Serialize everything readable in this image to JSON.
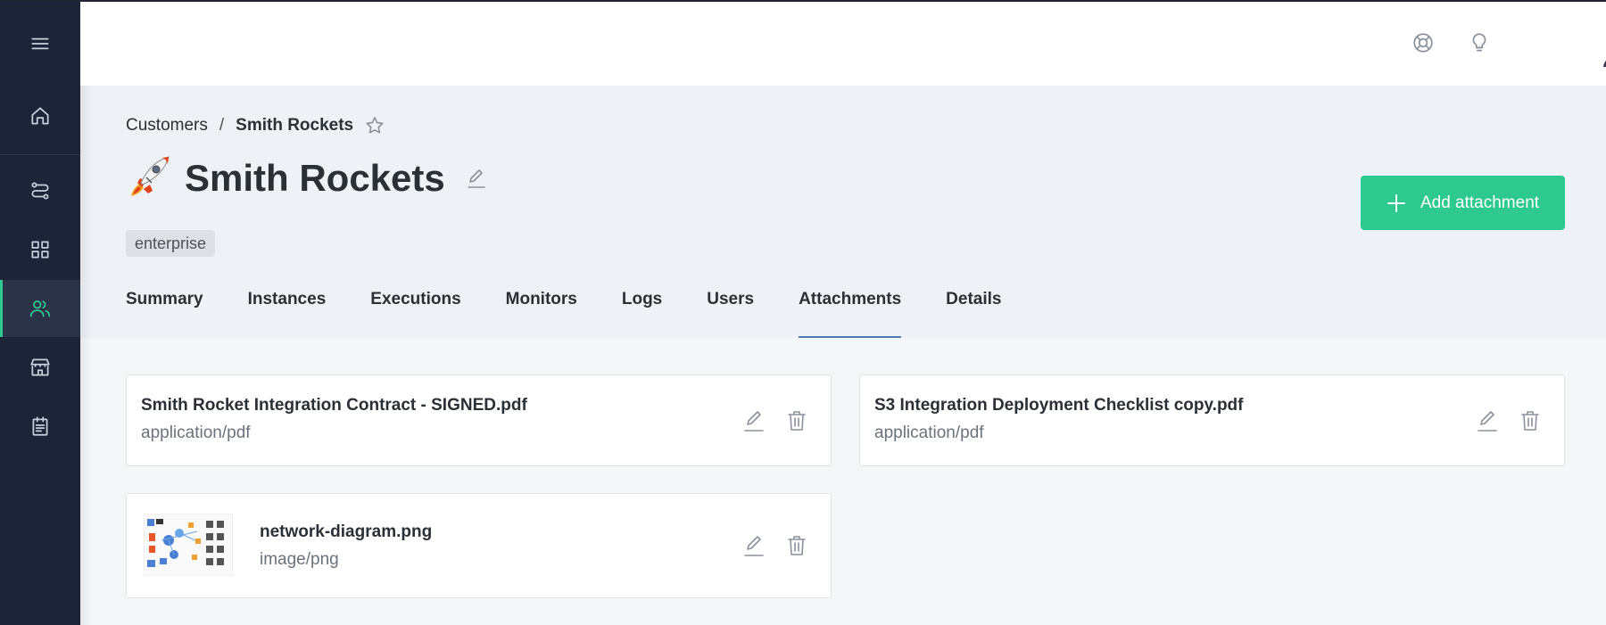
{
  "breadcrumb": {
    "root": "Customers",
    "separator": "/",
    "current": "Smith Rockets"
  },
  "page": {
    "title": "Smith Rockets",
    "tag": "enterprise"
  },
  "actions": {
    "add_attachment_label": "Add attachment"
  },
  "tabs": [
    {
      "label": "Summary",
      "active": false
    },
    {
      "label": "Instances",
      "active": false
    },
    {
      "label": "Executions",
      "active": false
    },
    {
      "label": "Monitors",
      "active": false
    },
    {
      "label": "Logs",
      "active": false
    },
    {
      "label": "Users",
      "active": false
    },
    {
      "label": "Attachments",
      "active": true
    },
    {
      "label": "Details",
      "active": false
    }
  ],
  "attachments": [
    {
      "name": "Smith Rocket Integration Contract - SIGNED.pdf",
      "type": "application/pdf"
    },
    {
      "name": "S3 Integration Deployment Checklist copy.pdf",
      "type": "application/pdf"
    },
    {
      "name": "network-diagram.png",
      "type": "image/png"
    }
  ],
  "sidebar": {
    "items": [
      {
        "icon": "menu-icon"
      },
      {
        "icon": "home-icon"
      },
      {
        "icon": "flow-icon"
      },
      {
        "icon": "grid-icon"
      },
      {
        "icon": "users-icon",
        "active": true
      },
      {
        "icon": "store-icon"
      },
      {
        "icon": "calendar-icon"
      }
    ]
  },
  "header_icons": [
    "help-icon",
    "lightbulb-icon",
    "avatar"
  ],
  "colors": {
    "accent": "#2ec98f",
    "sidebar": "#1d2437",
    "tab_underline": "#4f7bb5"
  }
}
